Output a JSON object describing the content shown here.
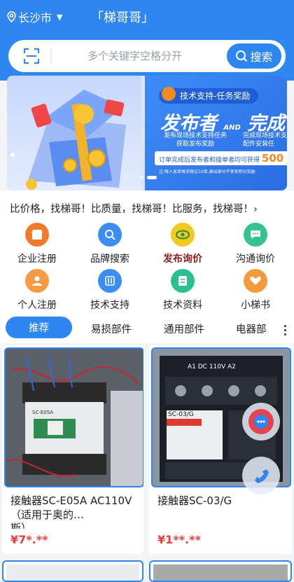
{
  "header": {
    "location": "长沙市",
    "title": "「梯哥哥」"
  },
  "search": {
    "placeholder": "多个关键字空格分开",
    "button_label": "搜索"
  },
  "banner": {
    "badge": "技术支持-任务奖励",
    "headline_left": "发布者",
    "headline_and": "AND",
    "headline_right": "完成",
    "sub1": "发布现场技术支持任务",
    "sub2": "获取发布奖励",
    "sub3": "完成现场技术支",
    "sub4": "配件安装任",
    "reward_text": "订单完成后发布者和接单者均可获得",
    "reward_amount": "500",
    "note": "注:每人发单每天限过10单,被出部分不享受积分奖励"
  },
  "marquee": "比价格，找梯哥！比质量，找梯哥！比服务，找梯哥！›",
  "categories": [
    {
      "label": "企业注册",
      "color": "#f07a2c"
    },
    {
      "label": "品牌搜索",
      "color": "#3a8df2"
    },
    {
      "label": "发布询价",
      "color": "#f2c91e"
    },
    {
      "label": "沟通询价",
      "color": "#35c28f"
    },
    {
      "label": "个人注册",
      "color": "#f59a45"
    },
    {
      "label": "技术支持",
      "color": "#3a8df2"
    },
    {
      "label": "技术资料",
      "color": "#2cc090"
    },
    {
      "label": "小梯书",
      "color": "#f29a3c"
    }
  ],
  "tabs": [
    "推荐",
    "易损部件",
    "通用部件",
    "电器部"
  ],
  "products": [
    {
      "title": "接触器SC-E05A AC110V（适用于奥的…",
      "title_cont": "斯）",
      "price": "¥7*.**"
    },
    {
      "title": "接触器SC-03/G",
      "price": "¥1**.**"
    }
  ],
  "photo_text": {
    "p1_label1": "SC-E05A",
    "p2_label1": "SC-03/G",
    "p2_top": "A1 DC 110V A2"
  },
  "colors": {
    "primary": "#2e86f0",
    "price": "#ef3b3b",
    "highlight_label": "#8b1c1c"
  }
}
